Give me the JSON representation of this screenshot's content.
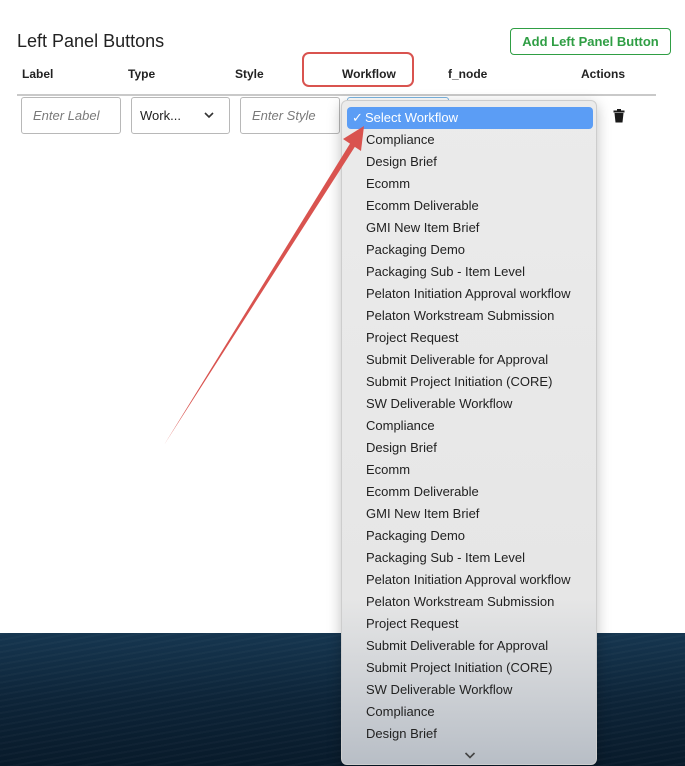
{
  "page": {
    "title": "Left Panel Buttons",
    "add_button_label": "Add Left Panel Button"
  },
  "table": {
    "headers": {
      "label": "Label",
      "type": "Type",
      "style": "Style",
      "workflow": "Workflow",
      "f_node": "f_node",
      "actions": "Actions"
    },
    "row": {
      "label_placeholder": "Enter Label",
      "type_value": "Work...",
      "style_placeholder": "Enter Style"
    }
  },
  "dropdown": {
    "selected": "Select Workflow",
    "options": [
      "Compliance",
      "Design Brief",
      "Ecomm",
      "Ecomm Deliverable",
      "GMI New Item Brief",
      "Packaging Demo",
      "Packaging Sub - Item Level",
      "Pelaton Initiation Approval workflow",
      "Pelaton Workstream Submission",
      "Project Request",
      "Submit Deliverable for Approval",
      "Submit Project Initiation (CORE)",
      "SW Deliverable Workflow",
      "Compliance",
      "Design Brief",
      "Ecomm",
      "Ecomm Deliverable",
      "GMI New Item Brief",
      "Packaging Demo",
      "Packaging Sub - Item Level",
      "Pelaton Initiation Approval workflow",
      "Pelaton Workstream Submission",
      "Project Request",
      "Submit Deliverable for Approval",
      "Submit Project Initiation (CORE)",
      "SW Deliverable Workflow",
      "Compliance",
      "Design Brief"
    ]
  },
  "icons": {
    "type_chevron": "chevron-down-icon",
    "delete": "trash-icon",
    "check": "check-icon",
    "scroll_more": "chevron-down-icon"
  },
  "colors": {
    "accent_green": "#2f9e44",
    "highlight_red": "#d9534f",
    "selection_blue": "#5b9df5"
  }
}
